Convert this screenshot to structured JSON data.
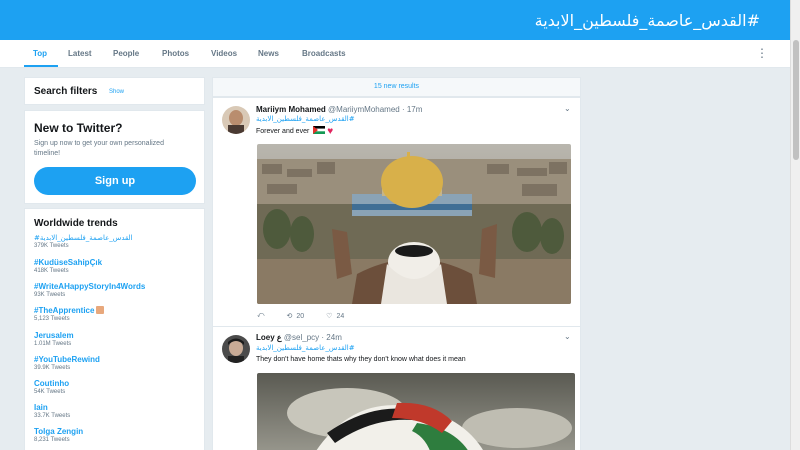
{
  "header": {
    "search_query": "#القدس_عاصمة_فلسطين_الابدية"
  },
  "nav": {
    "tabs": [
      {
        "label": "Top",
        "active": true
      },
      {
        "label": "Latest"
      },
      {
        "label": "People"
      },
      {
        "label": "Photos"
      },
      {
        "label": "Videos"
      },
      {
        "label": "News"
      },
      {
        "label": "Broadcasts"
      }
    ],
    "more_icon": "⋮"
  },
  "search_filters": {
    "title": "Search filters",
    "show_label": "Show"
  },
  "new_to_twitter": {
    "title": "New to Twitter?",
    "body": "Sign up now to get your own personalized timeline!",
    "button": "Sign up"
  },
  "trends": {
    "title": "Worldwide trends",
    "items": [
      {
        "name": "#القدس_عاصمة_فلسطين_الابدية",
        "count": "379K Tweets"
      },
      {
        "name": "#KudüseSahipÇık",
        "count": "418K Tweets"
      },
      {
        "name": "#WriteAHappyStoryIn4Words",
        "count": "93K Tweets"
      },
      {
        "name": "#TheApprentice",
        "count": "5,123 Tweets"
      },
      {
        "name": "Jerusalem",
        "count": "1.01M Tweets"
      },
      {
        "name": "#YouTubeRewind",
        "count": "39.9K Tweets"
      },
      {
        "name": "Coutinho",
        "count": "54K Tweets"
      },
      {
        "name": "Iain",
        "count": "33.7K Tweets"
      },
      {
        "name": "Tolga Zengin",
        "count": "8,231 Tweets"
      }
    ]
  },
  "timeline": {
    "new_results": "15 new results",
    "tweets": [
      {
        "name": "Mariiym Mohamed",
        "handle": "@MariiymMohamed",
        "time": "· 17m",
        "hashtag": "#القدس_عاصمة_فلسطين_الابدية",
        "text": "Forever and ever",
        "retweets": "20",
        "likes": "24"
      },
      {
        "name": "Loey",
        "name_suffix": "ع",
        "handle": "@sel_pcy",
        "time": "· 24m",
        "hashtag": "#القدس_عاصمة_فلسطين_الابدية",
        "text": "They don't have home thats why they don't know what does it mean"
      }
    ]
  },
  "colors": {
    "accent": "#1da1f2",
    "background": "#e6ecf0",
    "like": "#e0245e"
  }
}
